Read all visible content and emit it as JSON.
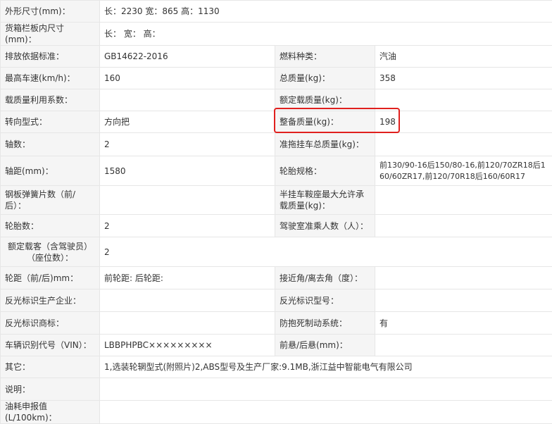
{
  "rows": [
    {
      "l1": "外形尺寸(mm)：",
      "v1": "长：2230 宽：865 高：1130"
    },
    {
      "l1": "货箱栏板内尺寸(mm)：",
      "v1": "长：  宽：  高："
    },
    {
      "l1": "排放依据标准：",
      "v1": "GB14622-2016",
      "l2": "燃料种类：",
      "v2": "汽油"
    },
    {
      "l1": "最高车速(km/h)：",
      "v1": "160",
      "l2": "总质量(kg)：",
      "v2": "358"
    },
    {
      "l1": "载质量利用系数：",
      "v1": "",
      "l2": "额定载质量(kg)：",
      "v2": ""
    },
    {
      "l1": "转向型式：",
      "v1": "方向把",
      "l2": "整备质量(kg)：",
      "v2": "198"
    },
    {
      "l1": "轴数：",
      "v1": "2",
      "l2": "准拖挂车总质量(kg)：",
      "v2": ""
    },
    {
      "l1": "轴距(mm)：",
      "v1": "1580",
      "l2": "轮胎规格：",
      "v2": "前130/90-16后150/80-16,前120/70ZR18后160/60ZR17,前120/70R18后160/60R17"
    },
    {
      "l1": "钢板弹簧片数（前/后）：",
      "v1": "",
      "l2": "半挂车鞍座最大允许承载质量(kg)：",
      "v2": ""
    },
    {
      "l1": "轮胎数：",
      "v1": "2",
      "l2": "驾驶室准乘人数（人）：",
      "v2": ""
    },
    {
      "l1": "额定载客（含驾驶员）（座位数）：",
      "v1": "2"
    },
    {
      "l1": "轮距（前/后)mm：",
      "v1": "前轮距: 后轮距:",
      "l2": "接近角/离去角（度）：",
      "v2": ""
    },
    {
      "l1": "反光标识生产企业：",
      "v1": "",
      "l2": "反光标识型号：",
      "v2": ""
    },
    {
      "l1": "反光标识商标：",
      "v1": "",
      "l2": "防抱死制动系统：",
      "v2": "有"
    },
    {
      "l1": "车辆识别代号（VIN）：",
      "v1": "LBBPHPBC×××××××××",
      "l2": "前悬/后悬(mm)：",
      "v2": ""
    },
    {
      "l1": "其它：",
      "v1": "1,选装轮辋型式(附照片)2,ABS型号及生产厂家:9.1MB,浙江益中智能电气有限公司"
    },
    {
      "l1": "说明：",
      "v1": ""
    },
    {
      "l1": "油耗申报值(L/100km)：",
      "v1": ""
    }
  ],
  "highlight_color": "#e0201e"
}
